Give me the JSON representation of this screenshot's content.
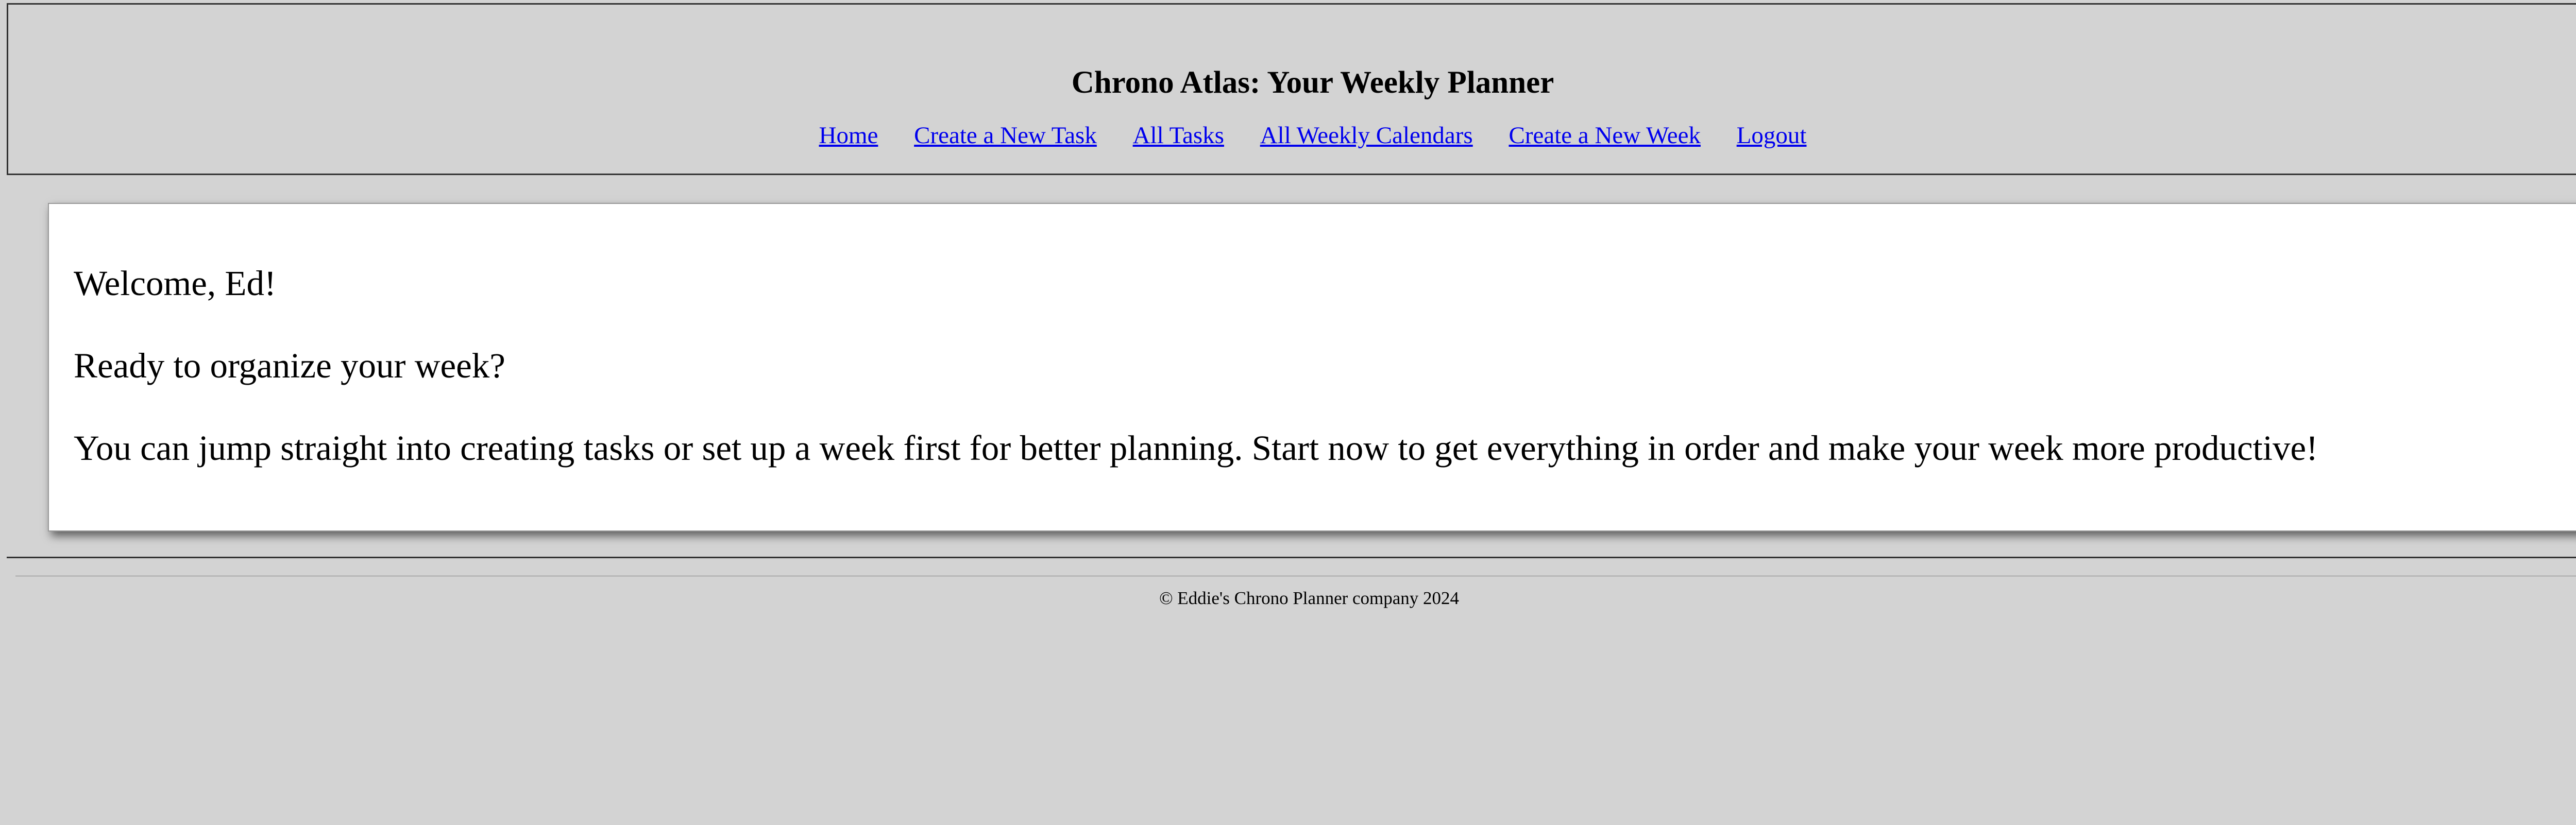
{
  "header": {
    "title": "Chrono Atlas: Your Weekly Planner",
    "nav": [
      {
        "label": "Home"
      },
      {
        "label": "Create a New Task"
      },
      {
        "label": "All Tasks"
      },
      {
        "label": "All Weekly Calendars"
      },
      {
        "label": "Create a New Week"
      },
      {
        "label": "Logout"
      }
    ]
  },
  "main": {
    "welcome": "Welcome, Ed!",
    "prompt": "Ready to organize your week?",
    "description": "You can jump straight into creating tasks or set up a week first for better planning. Start now to get everything in order and make your week more productive!"
  },
  "footer": {
    "copyright": "© Eddie's Chrono Planner company 2024"
  },
  "colors": {
    "background": "#d3d3d3",
    "link": "#0000ee",
    "card": "#ffffff"
  }
}
